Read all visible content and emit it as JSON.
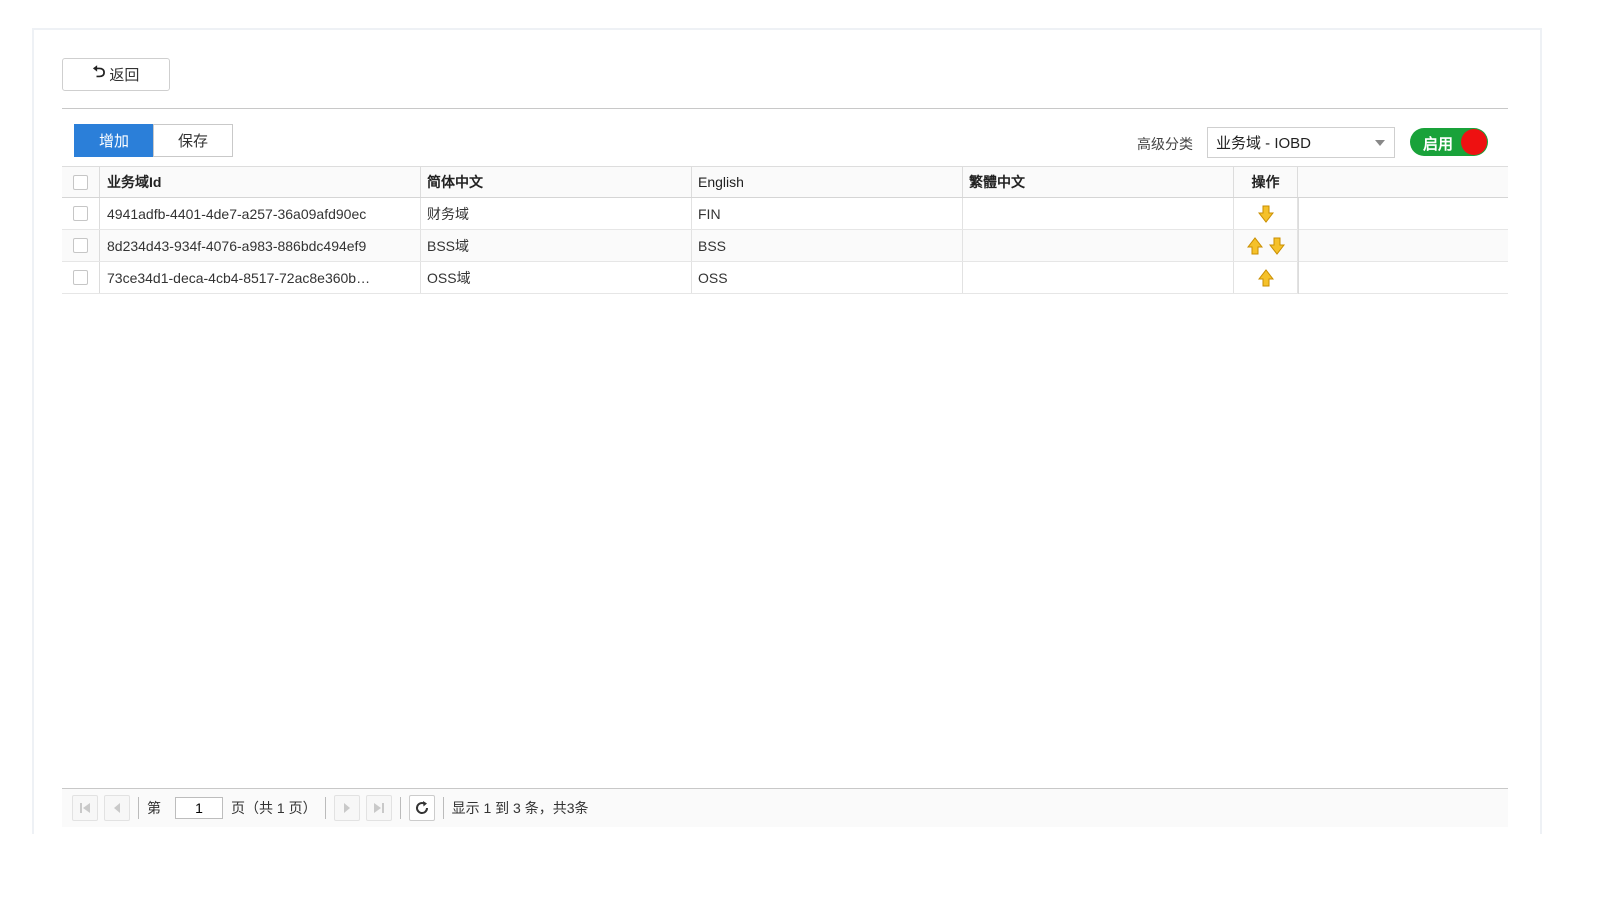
{
  "back_button": {
    "icon": "return-arrow-icon",
    "label": "返回"
  },
  "toolbar": {
    "add_label": "增加",
    "save_label": "保存"
  },
  "filter": {
    "label": "高级分类",
    "selected": "业务域 - IOBD"
  },
  "toggle": {
    "label": "启用",
    "on_color": "#19a23a",
    "knob_color": "#ee1111"
  },
  "table": {
    "columns": [
      "业务域Id",
      "简体中文",
      "English",
      "繁體中文",
      "操作"
    ],
    "rows": [
      {
        "id": "4941adfb-4401-4de7-a257-36a09afd90ec",
        "zh": "财务域",
        "en": "FIN",
        "tw": "",
        "actions": [
          "down"
        ]
      },
      {
        "id": "8d234d43-934f-4076-a983-886bdc494ef9",
        "zh": "BSS域",
        "en": "BSS",
        "tw": "",
        "actions": [
          "up",
          "down"
        ]
      },
      {
        "id": "73ce34d1-deca-4cb4-8517-72ac8e360b…",
        "zh": "OSS域",
        "en": "OSS",
        "tw": "",
        "actions": [
          "up"
        ]
      }
    ]
  },
  "pager": {
    "page_prefix": "第",
    "current_page": "1",
    "page_suffix": "页（共 1 页）",
    "summary": "显示 1 到 3 条，共3条"
  },
  "colors": {
    "primary": "#2b7fd9",
    "arrow": "#f2b515"
  }
}
